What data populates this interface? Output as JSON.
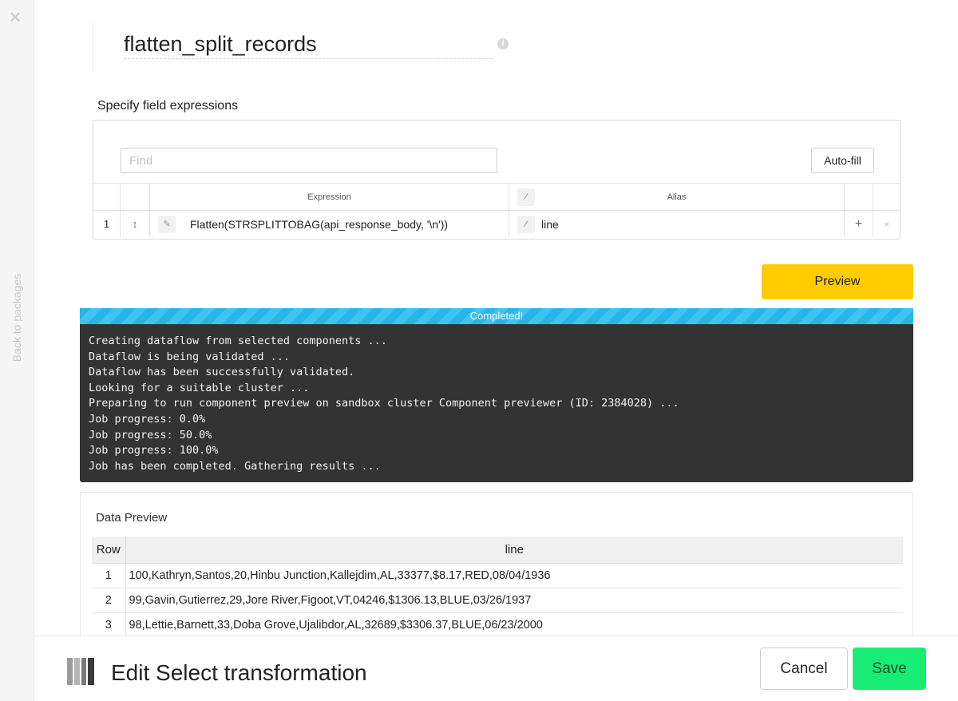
{
  "sidebar": {
    "close_glyph": "×",
    "back_label": "Back to packages"
  },
  "component": {
    "name": "flatten_split_records",
    "info_glyph": "i"
  },
  "field_expressions": {
    "title": "Specify field expressions",
    "find_placeholder": "Find",
    "autofill_label": "Auto-fill",
    "columns": {
      "expression": "Expression",
      "alias": "Alias"
    },
    "rows": [
      {
        "num": "1",
        "expression": "Flatten(STRSPLITTOBAG(api_response_body, '\\n'))",
        "alias": "line"
      }
    ],
    "icons": {
      "drag": "↕",
      "edit": "✎",
      "wand": "⁄",
      "add": "+",
      "remove": "×"
    }
  },
  "preview": {
    "button_label": "Preview",
    "status": "Completed!",
    "log": [
      "Creating dataflow from selected components ...",
      "Dataflow is being validated ...",
      "Dataflow has been successfully validated.",
      "Looking for a suitable cluster ...",
      "Preparing to run component preview on sandbox cluster Component previewer (ID: 2384028) ...",
      "Job progress: 0.0%",
      "Job progress: 50.0%",
      "Job progress: 100.0%",
      "Job has been completed. Gathering results ..."
    ]
  },
  "data_preview": {
    "title": "Data Preview",
    "columns": {
      "row": "Row",
      "line": "line"
    },
    "rows": [
      {
        "row": "1",
        "line": "100,Kathryn,Santos,20,Hinbu Junction,Kallejdim,AL,33377,$8.17,RED,08/04/1936"
      },
      {
        "row": "2",
        "line": "99,Gavin,Gutierrez,29,Jore River,Figoot,VT,04246,$1306.13,BLUE,03/26/1937"
      },
      {
        "row": "3",
        "line": "98,Lettie,Barnett,33,Doba Grove,Ujalibdor,AL,32689,$3306.37,BLUE,06/23/2000"
      }
    ]
  },
  "footer": {
    "title": "Edit Select transformation",
    "icon": "select-transformation-icon",
    "cancel_label": "Cancel",
    "save_label": "Save"
  },
  "colors": {
    "preview_button": "#ffcc00",
    "save_button": "#19ec74",
    "progress": "#26b6e8",
    "console_bg": "#333333"
  }
}
